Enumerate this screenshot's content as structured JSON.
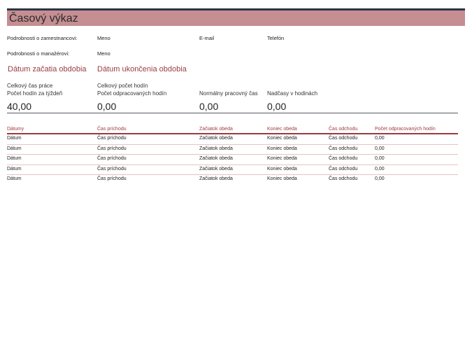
{
  "title": "Časový výkaz",
  "employee": {
    "label": "Podrobnosti o zamestnancovi:",
    "name": "Meno",
    "email": "E-mail",
    "phone": "Telefón"
  },
  "manager": {
    "label": "Podrobnosti o manažérovi:",
    "name": "Meno"
  },
  "period": {
    "start": "Dátum začatia obdobia",
    "end": "Dátum ukončenia obdobia"
  },
  "summary": {
    "total_work_time_label": "Celkový čas práce",
    "hours_per_week_label": "Počet hodín za týždeň",
    "hours_per_week_value": "40,00",
    "total_hours_label": "Celkový počet hodín",
    "worked_hours_label": "Počet odpracovaných hodín",
    "worked_hours_value": "0,00",
    "normal_time_label": "Normálny pracovný čas",
    "normal_time_value": "0,00",
    "overtime_label": "Nadčasy v hodinách",
    "overtime_value": "0,00"
  },
  "table": {
    "headers": [
      "Dátumy",
      "Čas príchodu",
      "Začiatok obeda",
      "Koniec obeda",
      "Čas odchodu",
      "Počet odpracovaných hodín"
    ],
    "rows": [
      [
        "Dátum",
        "Čas príchodu",
        "Začiatok obeda",
        "Koniec obeda",
        "Čas odchodu",
        "0,00"
      ],
      [
        "Dátum",
        "Čas príchodu",
        "Začiatok obeda",
        "Koniec obeda",
        "Čas odchodu",
        "0,00"
      ],
      [
        "Dátum",
        "Čas príchodu",
        "Začiatok obeda",
        "Koniec obeda",
        "Čas odchodu",
        "0,00"
      ],
      [
        "Dátum",
        "Čas príchodu",
        "Začiatok obeda",
        "Koniec obeda",
        "Čas odchodu",
        "0,00"
      ],
      [
        "Dátum",
        "Čas príchodu",
        "Začiatok obeda",
        "Koniec obeda",
        "Čas odchodu",
        "0,00"
      ]
    ]
  },
  "colors": {
    "title_bar": "#c58e92",
    "accent": "#9b3b42",
    "top_rule": "#2d3445"
  }
}
